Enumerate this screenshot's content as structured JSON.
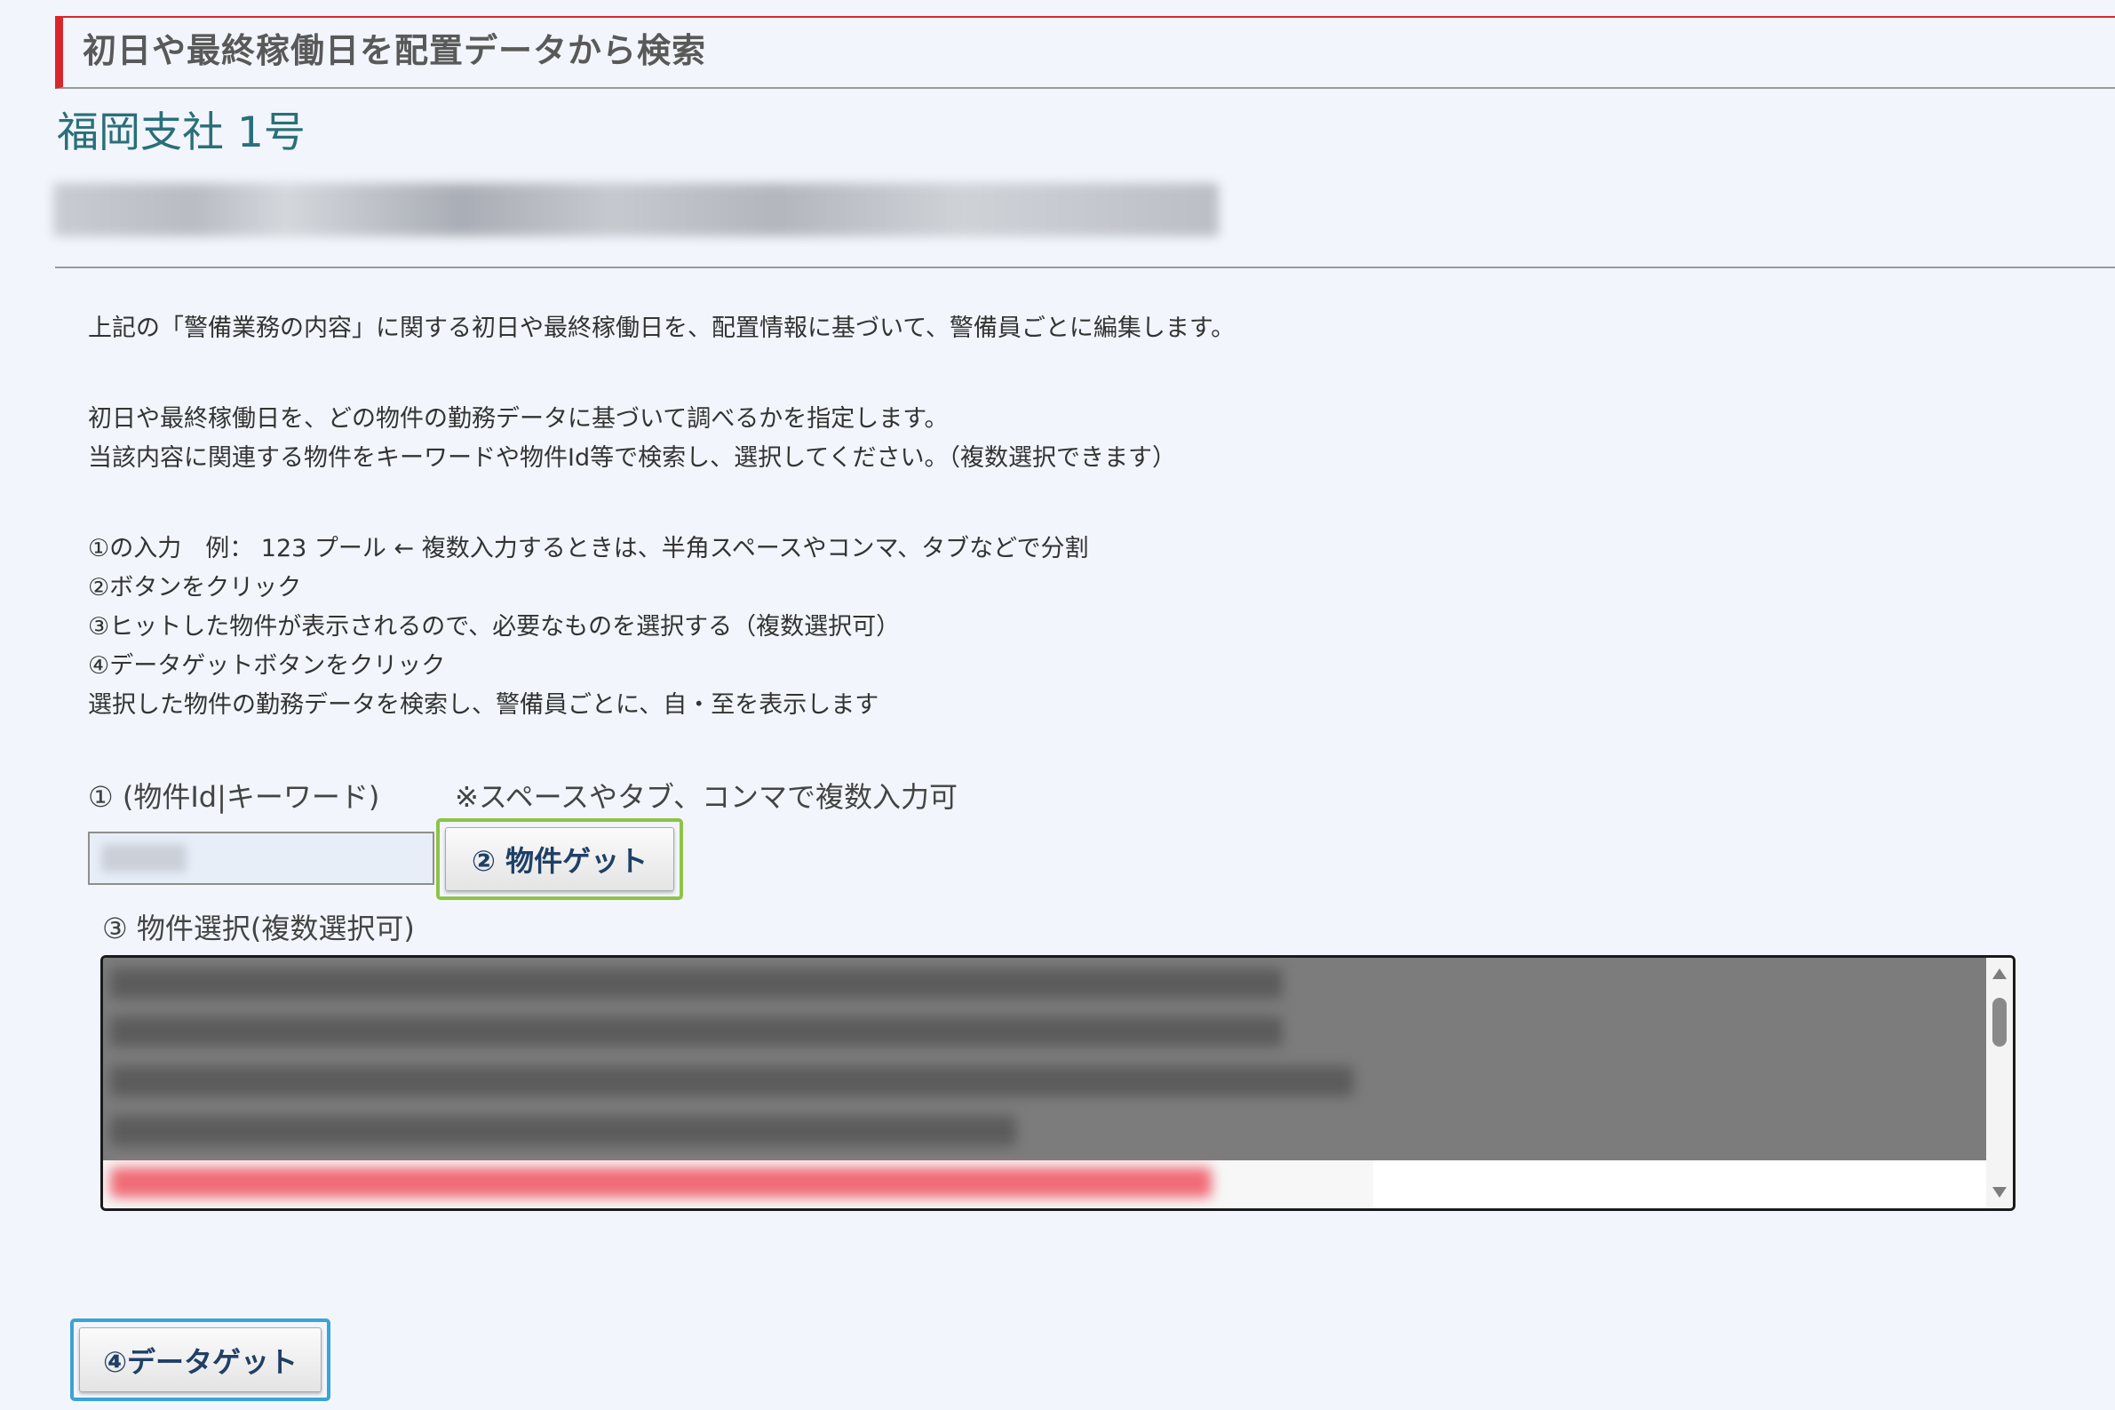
{
  "section": {
    "title": "初日や最終稼働日を配置データから検索"
  },
  "branch_label": "福岡支社 1号",
  "description": {
    "intro": "上記の「警備業務の内容」に関する初日や最終稼働日を、配置情報に基づいて、警備員ごとに編集します。",
    "lines": [
      "初日や最終稼働日を、どの物件の勤務データに基づいて調べるかを指定します。",
      "当該内容に関連する物件をキーワードや物件Id等で検索し、選択してください。（複数選択できます）"
    ],
    "steps": [
      "①の入力　例： 123 プール ← 複数入力するときは、半角スペースやコンマ、タブなどで分割",
      "②ボタンをクリック",
      "③ヒットした物件が表示されるので、必要なものを選択する（複数選択可）",
      "④データゲットボタンをクリック",
      "選択した物件の勤務データを検索し、警備員ごとに、自・至を表示します"
    ]
  },
  "keyword_field": {
    "label": "① (物件Id|キーワード)",
    "hint": "※スペースやタブ、コンマで複数入力可"
  },
  "get_property_button": "② 物件ゲット",
  "property_select_label": "③ 物件選択(複数選択可)",
  "get_data_button": "④データゲット",
  "colors": {
    "accent_red": "#d9262c",
    "branch_teal": "#2a6f79",
    "button_text": "#1f3f66",
    "focus_green": "#8dc447",
    "focus_blue": "#3aa3d8",
    "selected_row_red": "#f06b76"
  },
  "icons": {
    "scroll_up": "scroll-up-arrow-icon",
    "scroll_down": "scroll-down-arrow-icon"
  }
}
